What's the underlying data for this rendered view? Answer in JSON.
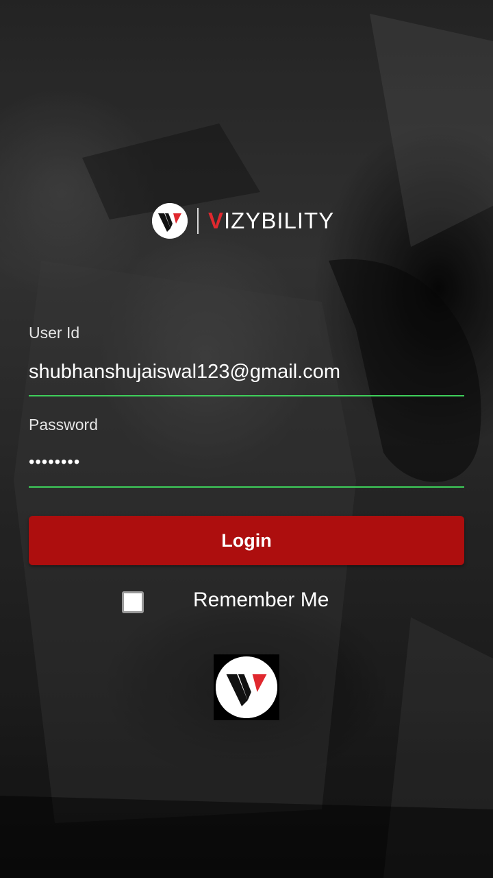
{
  "brand": {
    "name": "VIZYBILITY",
    "name_first_letter": "V",
    "name_rest": "IZYBILITY",
    "colors": {
      "red": "#e0282e",
      "button": "#ad0e0e",
      "underline": "#3ecf5a"
    }
  },
  "form": {
    "user_id_label": "User Id",
    "user_id_value": "shubhanshujaiswal123@gmail.com",
    "password_label": "Password",
    "password_value": "••••••••",
    "login_label": "Login",
    "remember_label": "Remember Me",
    "remember_checked": false
  },
  "icons": {
    "header_logo": "vizybility-logo-icon",
    "footer_logo": "vizybility-logo-icon"
  }
}
